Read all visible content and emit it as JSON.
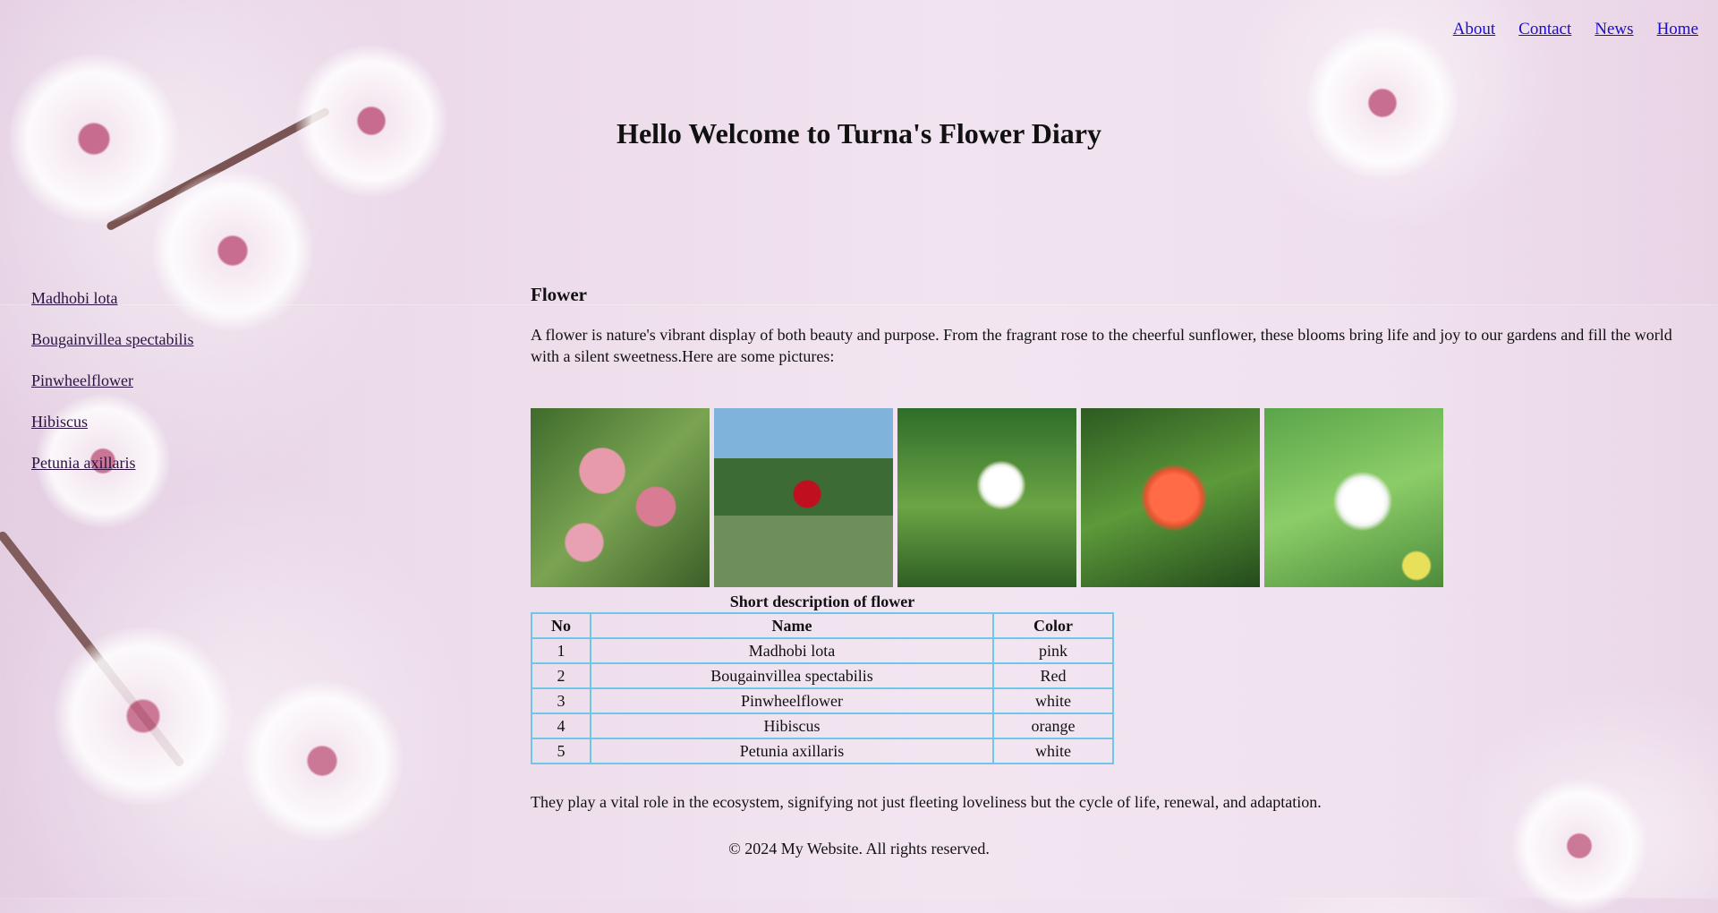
{
  "nav": {
    "items": [
      "About",
      "Contact",
      "News",
      "Home"
    ]
  },
  "header": {
    "line1": "Hello",
    "line2": "Welcome to Turna's Flower Diary"
  },
  "sidebar": {
    "items": [
      "Madhobi lota",
      "Bougainvillea spectabilis",
      "Pinwheelflower",
      "Hibiscus",
      "Petunia axillaris"
    ]
  },
  "main": {
    "heading": "Flower",
    "intro": "A flower is nature's vibrant display of both beauty and purpose. From the fragrant rose to the cheerful sunflower, these blooms bring life and joy to our gardens and fill the world with a silent sweetness.Here are some pictures:",
    "table": {
      "caption": "Short description of flower",
      "headers": [
        "No",
        "Name",
        "Color"
      ],
      "rows": [
        [
          "1",
          "Madhobi lota",
          "pink"
        ],
        [
          "2",
          "Bougainvillea spectabilis",
          "Red"
        ],
        [
          "3",
          "Pinwheelflower",
          "white"
        ],
        [
          "4",
          "Hibiscus",
          "orange"
        ],
        [
          "5",
          "Petunia axillaris",
          "white"
        ]
      ]
    },
    "outro": "They play a vital role in the ecosystem, signifying not just fleeting loveliness but the cycle of life, renewal, and adaptation."
  },
  "footer": {
    "text": "© 2024 My Website. All rights reserved."
  },
  "colors": {
    "link": "#1a0dcc",
    "table_border": "#6ec6e8",
    "background": "#ecdaea"
  }
}
